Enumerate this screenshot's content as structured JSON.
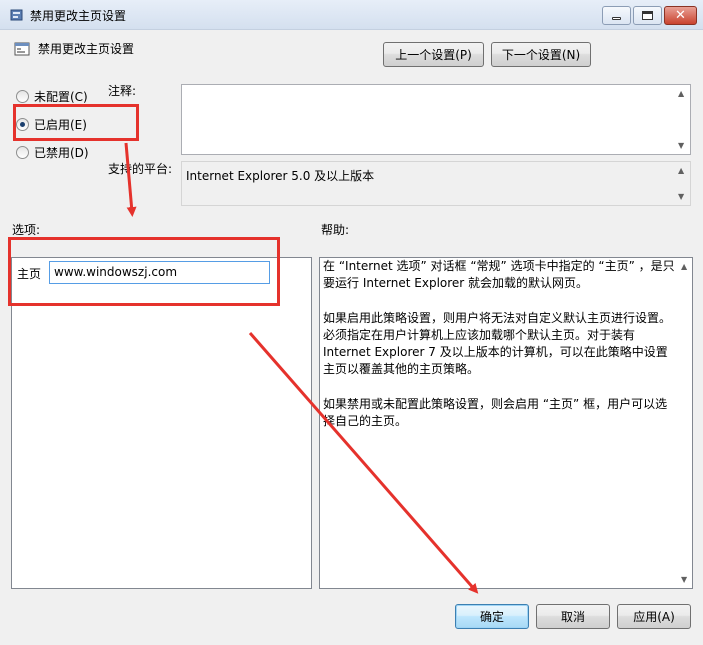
{
  "window": {
    "title": "禁用更改主页设置",
    "icon": "policy-settings-icon",
    "controls": {
      "minimize": "minimize-icon",
      "maximize": "maximize-icon",
      "close": "close-icon"
    }
  },
  "header": {
    "policy_title": "禁用更改主页设置",
    "prev_button": "上一个设置(P)",
    "next_button": "下一个设置(N)"
  },
  "state": {
    "options": [
      {
        "label": "未配置(C)",
        "checked": false
      },
      {
        "label": "已启用(E)",
        "checked": true
      },
      {
        "label": "已禁用(D)",
        "checked": false
      }
    ]
  },
  "comment": {
    "label": "注释:",
    "value": ""
  },
  "supported": {
    "label": "支持的平台:",
    "value": "Internet Explorer 5.0 及以上版本"
  },
  "options_section": {
    "label": "选项:",
    "homepage_label": "主页",
    "homepage_value": "www.windowszj.com"
  },
  "help_section": {
    "label": "帮助:",
    "paragraphs": [
      "在 “Internet 选项” 对话框 “常规” 选项卡中指定的 “主页” ，是只要运行 Internet Explorer 就会加载的默认网页。",
      "如果启用此策略设置，则用户将无法对自定义默认主页进行设置。必须指定在用户计算机上应该加载哪个默认主页。对于装有 Internet Explorer 7 及以上版本的计算机，可以在此策略中设置主页以覆盖其他的主页策略。",
      "如果禁用或未配置此策略设置，则会启用 “主页” 框，用户可以选择自己的主页。"
    ]
  },
  "footer": {
    "ok_button": "确定",
    "cancel_button": "取消",
    "apply_button": "应用(A)"
  },
  "colors": {
    "annotation_red": "#e5322c",
    "window_bg": "#f0f0f0"
  }
}
